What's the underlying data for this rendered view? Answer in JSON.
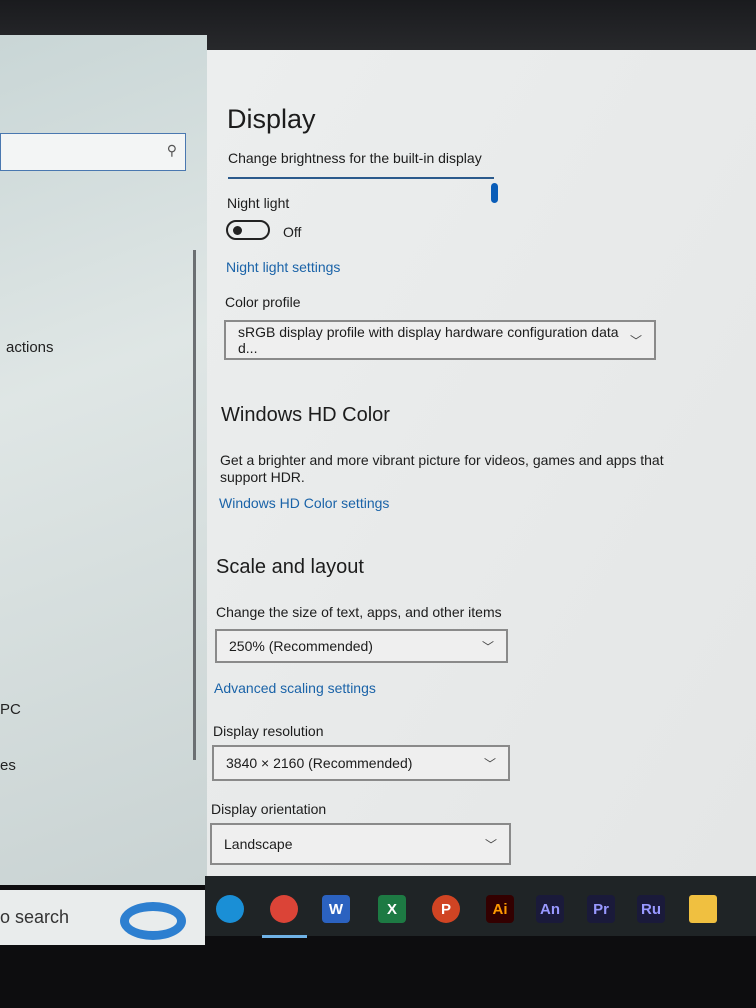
{
  "sidebar": {
    "search_icon": "search-icon",
    "items": [
      "actions",
      "PC",
      "es"
    ]
  },
  "display": {
    "title": "Display",
    "brightness_label": "Change brightness for the built-in display",
    "brightness_percent": 100,
    "night_light_label": "Night light",
    "night_light_state": "Off",
    "night_light_link": "Night light settings",
    "color_profile_label": "Color profile",
    "color_profile_value": "sRGB display profile with display hardware configuration data d..."
  },
  "hd_color": {
    "title": "Windows HD Color",
    "desc1": "Get a brighter and more vibrant picture for videos, games and apps that",
    "desc2": "support HDR.",
    "link": "Windows HD Color settings"
  },
  "scale": {
    "title": "Scale and layout",
    "size_label": "Change the size of text, apps, and other items",
    "size_value": "250% (Recommended)",
    "advanced_link": "Advanced scaling settings",
    "resolution_label": "Display resolution",
    "resolution_value": "3840 × 2160 (Recommended)",
    "orientation_label": "Display orientation",
    "orientation_value": "Landscape"
  },
  "taskbar": {
    "search_text": "o search",
    "apps": [
      {
        "name": "edge",
        "label": "",
        "color": "#1a8fd6"
      },
      {
        "name": "chrome",
        "label": "",
        "color": "#db4437"
      },
      {
        "name": "word",
        "label": "W",
        "color": "#2b62c0"
      },
      {
        "name": "excel",
        "label": "X",
        "color": "#1d7a43"
      },
      {
        "name": "powerpoint",
        "label": "P",
        "color": "#d04423"
      },
      {
        "name": "illustrator",
        "label": "Ai",
        "color": "#ff9a00"
      },
      {
        "name": "animate",
        "label": "An",
        "color": "#9999ff"
      },
      {
        "name": "premiere",
        "label": "Pr",
        "color": "#9999ff"
      },
      {
        "name": "rush",
        "label": "Ru",
        "color": "#9999ff"
      },
      {
        "name": "file-explorer",
        "label": "",
        "color": "#f0c040"
      }
    ]
  }
}
